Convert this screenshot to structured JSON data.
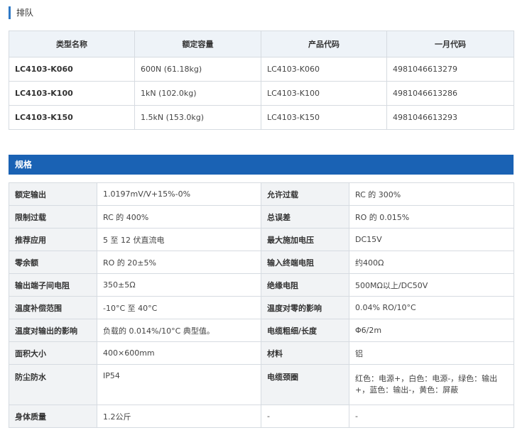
{
  "lineup_label": "排队",
  "lineup": {
    "headers": [
      "类型名称",
      "额定容量",
      "产品代码",
      "一月代码"
    ],
    "rows": [
      [
        "LC4103-K060",
        "600N (61.18kg)",
        "LC4103-K060",
        "4981046613279"
      ],
      [
        "LC4103-K100",
        "1kN (102.0kg)",
        "LC4103-K100",
        "4981046613286"
      ],
      [
        "LC4103-K150",
        "1.5kN (153.0kg)",
        "LC4103-K150",
        "4981046613293"
      ]
    ]
  },
  "spec_title": "规格",
  "spec_rows": [
    [
      "额定输出",
      "1.0197mV/V+15%-0%",
      "允许过载",
      "RC 的 300%"
    ],
    [
      "限制过载",
      "RC 的 400%",
      "总误差",
      "RO 的 0.015%"
    ],
    [
      "推荐应用",
      "5 至 12 伏直流电",
      "最大施加电压",
      "DC15V"
    ],
    [
      "零余额",
      "RO 的 20±5%",
      "输入终端电阻",
      "约400Ω"
    ],
    [
      "输出端子间电阻",
      "350±5Ω",
      "绝缘电阻",
      "500MΩ以上/DC50V"
    ],
    [
      "温度补偿范围",
      "-10°C 至 40°C",
      "温度对零的影响",
      "0.04% RO/10°C"
    ],
    [
      "温度对输出的影响",
      "负载的 0.014%/10°C 典型值。",
      "电缆粗细/长度",
      "Φ6/2m"
    ],
    [
      "面积大小",
      "400×600mm",
      "材料",
      "铝"
    ],
    [
      "防尘防水",
      "IP54",
      "电缆颈圈",
      "红色：电源+，白色：电源-，绿色：输出+，蓝色：输出-，黄色：屏蔽"
    ],
    [
      "身体质量",
      "1.2公斤",
      "-",
      "-"
    ]
  ]
}
